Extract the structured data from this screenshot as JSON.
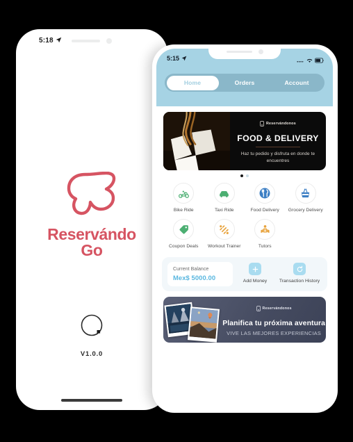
{
  "colors": {
    "brand_red": "#d65462",
    "header_blue": "#a6d3e4",
    "tab_track": "#8ab7c9",
    "icon_green": "#4caf72",
    "icon_blue": "#3d7fc4",
    "icon_orange": "#e8a33d",
    "balance_blue": "#59b7e0",
    "page_bg": "#000000"
  },
  "splash": {
    "status": {
      "time": "5:18",
      "location_icon": "location-arrow-icon"
    },
    "logo_icon": "reservando-r-cloud-logo",
    "brand_line1": "Reservándo",
    "brand_line2": "Go",
    "spinner_icon": "loading-spinner-icon",
    "version": "V1.0.0"
  },
  "app": {
    "status": {
      "time": "5:15",
      "location_icon": "location-arrow-icon",
      "signal_icon": "signal-dots-icon",
      "wifi_icon": "wifi-icon",
      "battery_icon": "battery-icon"
    },
    "tabs": [
      {
        "label": "Home",
        "active": true
      },
      {
        "label": "Orders",
        "active": false
      },
      {
        "label": "Account",
        "active": false
      }
    ],
    "banner1": {
      "brand": "Reservándonos",
      "brand_icon": "reservandonos-mark-icon",
      "title": "FOOD & DELIVERY",
      "subtitle": "Haz tu pedido y disfruta en donde te encuentres",
      "photo_alt": "noodle-takeout-box-photo",
      "dots": [
        true,
        false
      ]
    },
    "services": [
      {
        "label": "Bike Ride",
        "icon": "scooter-icon",
        "color": "#4caf72"
      },
      {
        "label": "Taxi Ride",
        "icon": "car-icon",
        "color": "#4caf72"
      },
      {
        "label": "Food\nDelivery",
        "icon": "cutlery-icon",
        "color": "#3d7fc4"
      },
      {
        "label": "Grocery\nDelivery",
        "icon": "basket-icon",
        "color": "#3d7fc4"
      },
      {
        "label": "Coupon\nDeals",
        "icon": "tag-icon",
        "color": "#4caf72"
      },
      {
        "label": "Workout\nTrainer",
        "icon": "dumbbell-icon",
        "color": "#e8a33d"
      },
      {
        "label": "Tutors",
        "icon": "tutor-icon",
        "color": "#e8a33d"
      }
    ],
    "wallet": {
      "balance_label": "Current Balance",
      "balance_value": "Mex$ 5000.00",
      "actions": [
        {
          "label": "Add\nMoney",
          "icon": "plus-icon"
        },
        {
          "label": "Transaction\nHistory",
          "icon": "refresh-icon"
        }
      ]
    },
    "banner2": {
      "brand": "Reservándonos",
      "brand_icon": "reservandonos-mark-icon",
      "title": "Planifica tu próxima aventura",
      "subtitle": "VIVE LAS MEJORES EXPERIENCIAS",
      "photo_alt": "travel-photo-collage"
    }
  }
}
